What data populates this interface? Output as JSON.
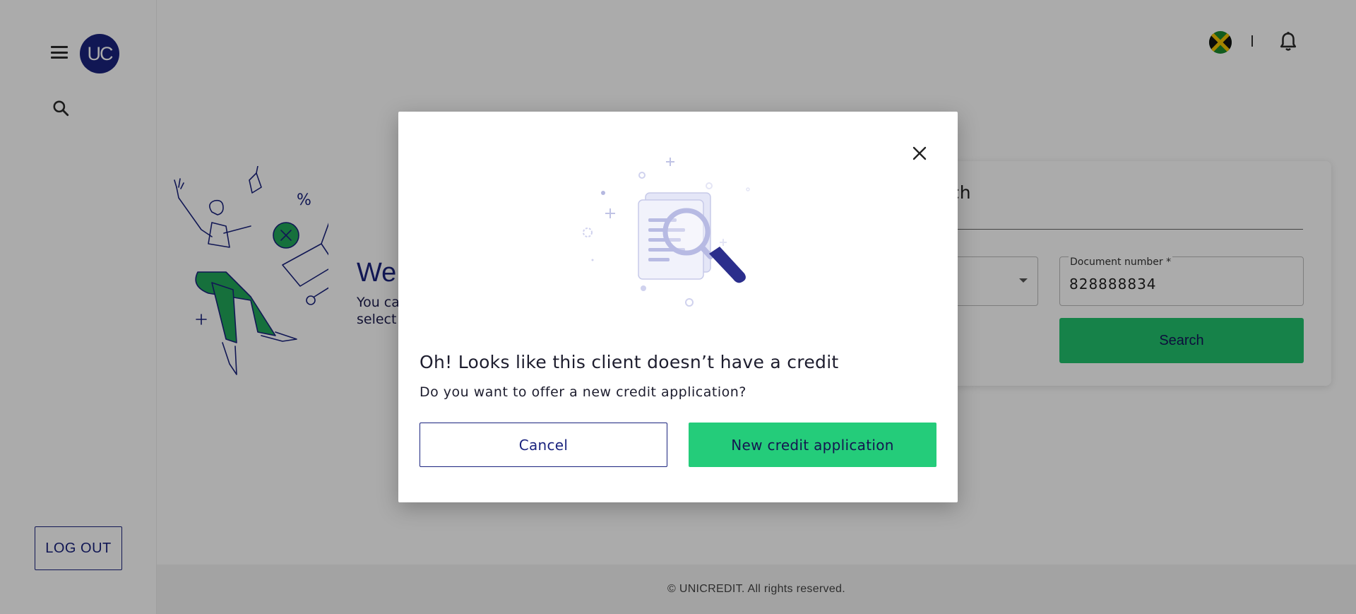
{
  "header": {
    "logo_text": "UC",
    "separator": "|"
  },
  "sidebar": {
    "logout_label": "LOG OUT"
  },
  "welcome": {
    "title": "We",
    "subtitle_line1": "You ca",
    "subtitle_line2": "select"
  },
  "search_card": {
    "title": "arch",
    "document_number_label": "Document number *",
    "document_number_value": "828888834",
    "search_button_label": "Search"
  },
  "modal": {
    "title": "Oh! Looks like this client doesn’t have a credit",
    "subtitle": "Do you want to offer a new credit application?",
    "cancel_label": "Cancel",
    "new_credit_label": "New credit application"
  },
  "footer": {
    "copyright": "© UNICREDIT. All rights reserved."
  },
  "colors": {
    "brand_navy": "#1a237e",
    "brand_green": "#24cc7a",
    "illustration_green": "#22a85a",
    "overlay": "rgba(0,0,0,0.33)"
  },
  "icons": {
    "menu": "menu-icon",
    "search": "search-icon",
    "bell": "bell-icon",
    "close": "close-icon",
    "flag": "jamaica-flag-icon",
    "dropdown": "chevron-down-icon"
  }
}
